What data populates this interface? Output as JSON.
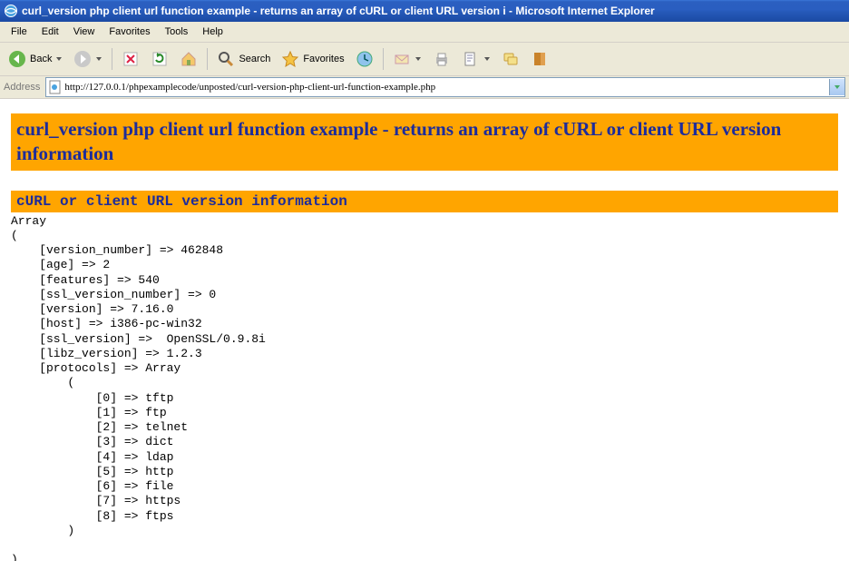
{
  "title": "curl_version php client url function example - returns an array of cURL or client URL version i - Microsoft Internet Explorer",
  "menu": {
    "file": "File",
    "edit": "Edit",
    "view": "View",
    "favorites": "Favorites",
    "tools": "Tools",
    "help": "Help"
  },
  "toolbar": {
    "back": "Back",
    "search": "Search",
    "favorites": "Favorites"
  },
  "address": {
    "label": "Address",
    "url": "http://127.0.0.1/phpexamplecode/unposted/curl-version-php-client-url-function-example.php"
  },
  "page": {
    "heading1": "curl_version php client url function example - returns an array of cURL or client URL version information",
    "heading2": "cURL or client URL version information",
    "output": "Array\n(\n    [version_number] => 462848\n    [age] => 2\n    [features] => 540\n    [ssl_version_number] => 0\n    [version] => 7.16.0\n    [host] => i386-pc-win32\n    [ssl_version] =>  OpenSSL/0.9.8i\n    [libz_version] => 1.2.3\n    [protocols] => Array\n        (\n            [0] => tftp\n            [1] => ftp\n            [2] => telnet\n            [3] => dict\n            [4] => ldap\n            [5] => http\n            [6] => file\n            [7] => https\n            [8] => ftps\n        )\n\n)"
  }
}
